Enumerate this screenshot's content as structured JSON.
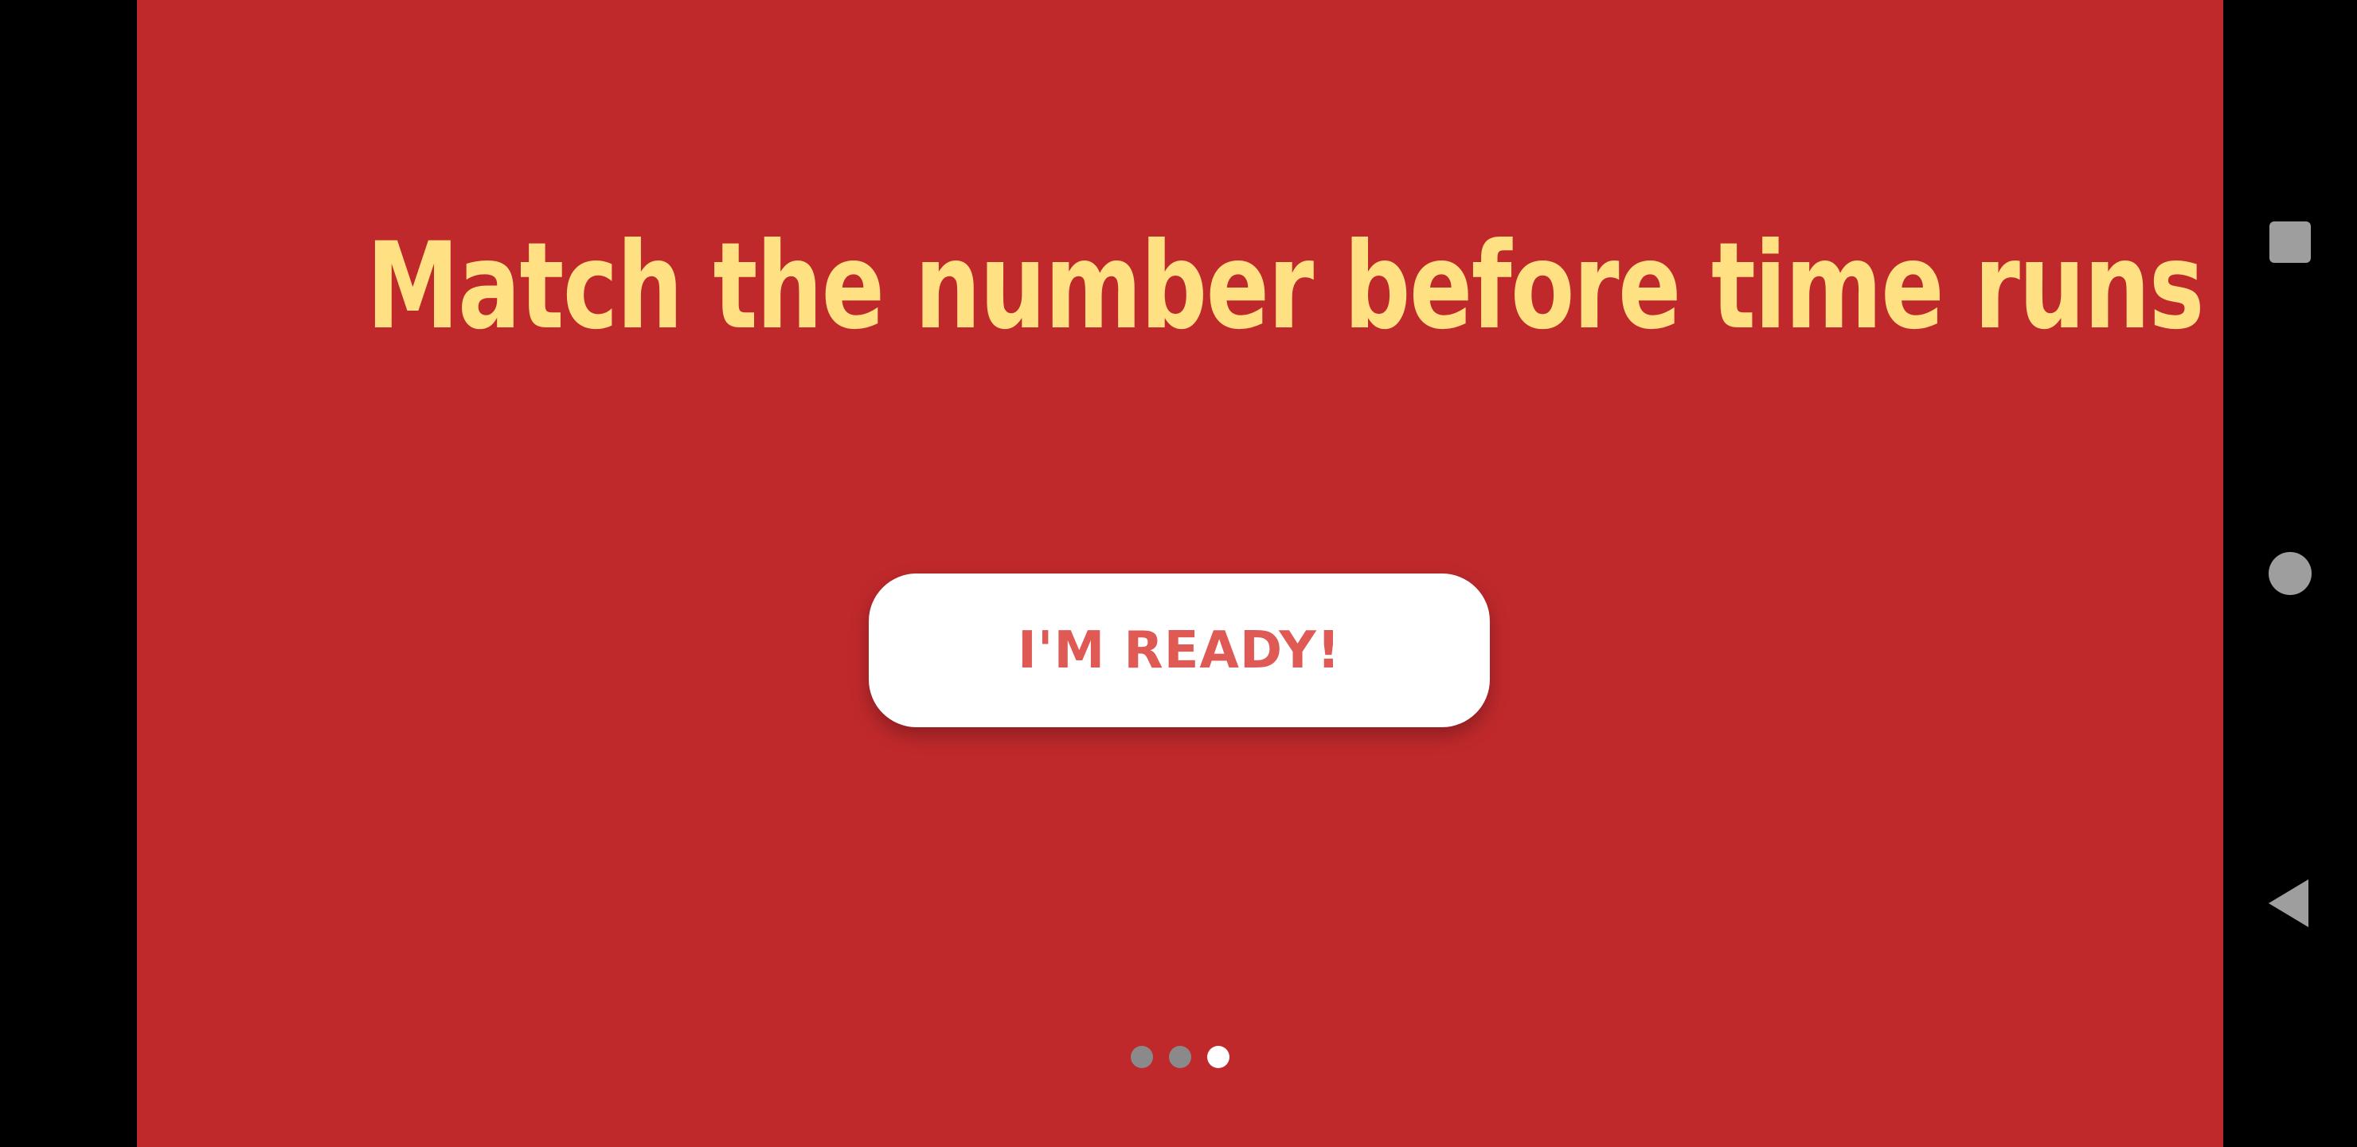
{
  "app": {
    "background_color": "#c0292c",
    "headline": "Match the number before time runs out!",
    "headline_color": "#ffe082",
    "ready_button_label": "I'M READY!",
    "ready_button_text_color": "#e05a55",
    "pager": {
      "page_count": 3,
      "current_page": 3,
      "active_color": "#ffffff",
      "inactive_color": "#8a8a8a"
    }
  },
  "system_nav": {
    "recent_icon": "square-recent-apps-icon",
    "home_icon": "circle-home-icon",
    "back_icon": "triangle-back-icon",
    "icon_color": "#9e9e9e"
  }
}
